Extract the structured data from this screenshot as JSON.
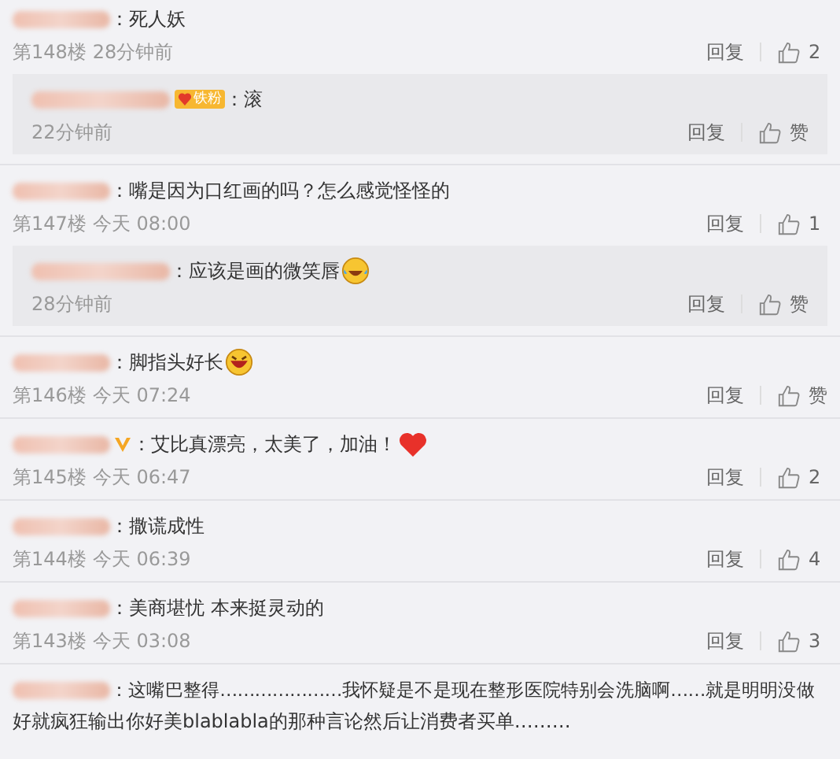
{
  "comments": [
    {
      "verified": false,
      "text": "：死人妖",
      "floor": "第148楼",
      "time": "28分钟前",
      "reply_label": "回复",
      "likes": "2",
      "replies": [
        {
          "badge": "铁粉",
          "text": "：滚",
          "time": "22分钟前",
          "reply_label": "回复",
          "likes": "赞"
        }
      ]
    },
    {
      "verified": false,
      "text": "：嘴是因为口红画的吗？怎么感觉怪怪的",
      "floor": "第147楼",
      "time": "今天 08:00",
      "reply_label": "回复",
      "likes": "1",
      "replies": [
        {
          "text": "：应该是画的微笑唇",
          "emoji": {
            "kind": "laugh-tears"
          },
          "time": "28分钟前",
          "reply_label": "回复",
          "likes": "赞"
        }
      ]
    },
    {
      "verified": false,
      "text": "：脚指头好长",
      "emoji": {
        "kind": "grin"
      },
      "floor": "第146楼",
      "time": "今天 07:24",
      "reply_label": "回复",
      "likes": "赞"
    },
    {
      "verified": true,
      "text": "：艾比真漂亮，太美了，加油！",
      "emoji": {
        "kind": "heart"
      },
      "floor": "第145楼",
      "time": "今天 06:47",
      "reply_label": "回复",
      "likes": "2"
    },
    {
      "verified": false,
      "text": "：撒谎成性",
      "floor": "第144楼",
      "time": "今天 06:39",
      "reply_label": "回复",
      "likes": "4"
    },
    {
      "verified": false,
      "text": "：美商堪忧 本来挺灵动的",
      "floor": "第143楼",
      "time": "今天 03:08",
      "reply_label": "回复",
      "likes": "3"
    },
    {
      "verified": false,
      "text": "：这嘴巴整得…………………我怀疑是不是现在整形医院特别会洗脑啊……就是明明没做",
      "text_continued": "好就疯狂输出你好美blablabla的那种言论然后让消费者买单………"
    }
  ]
}
